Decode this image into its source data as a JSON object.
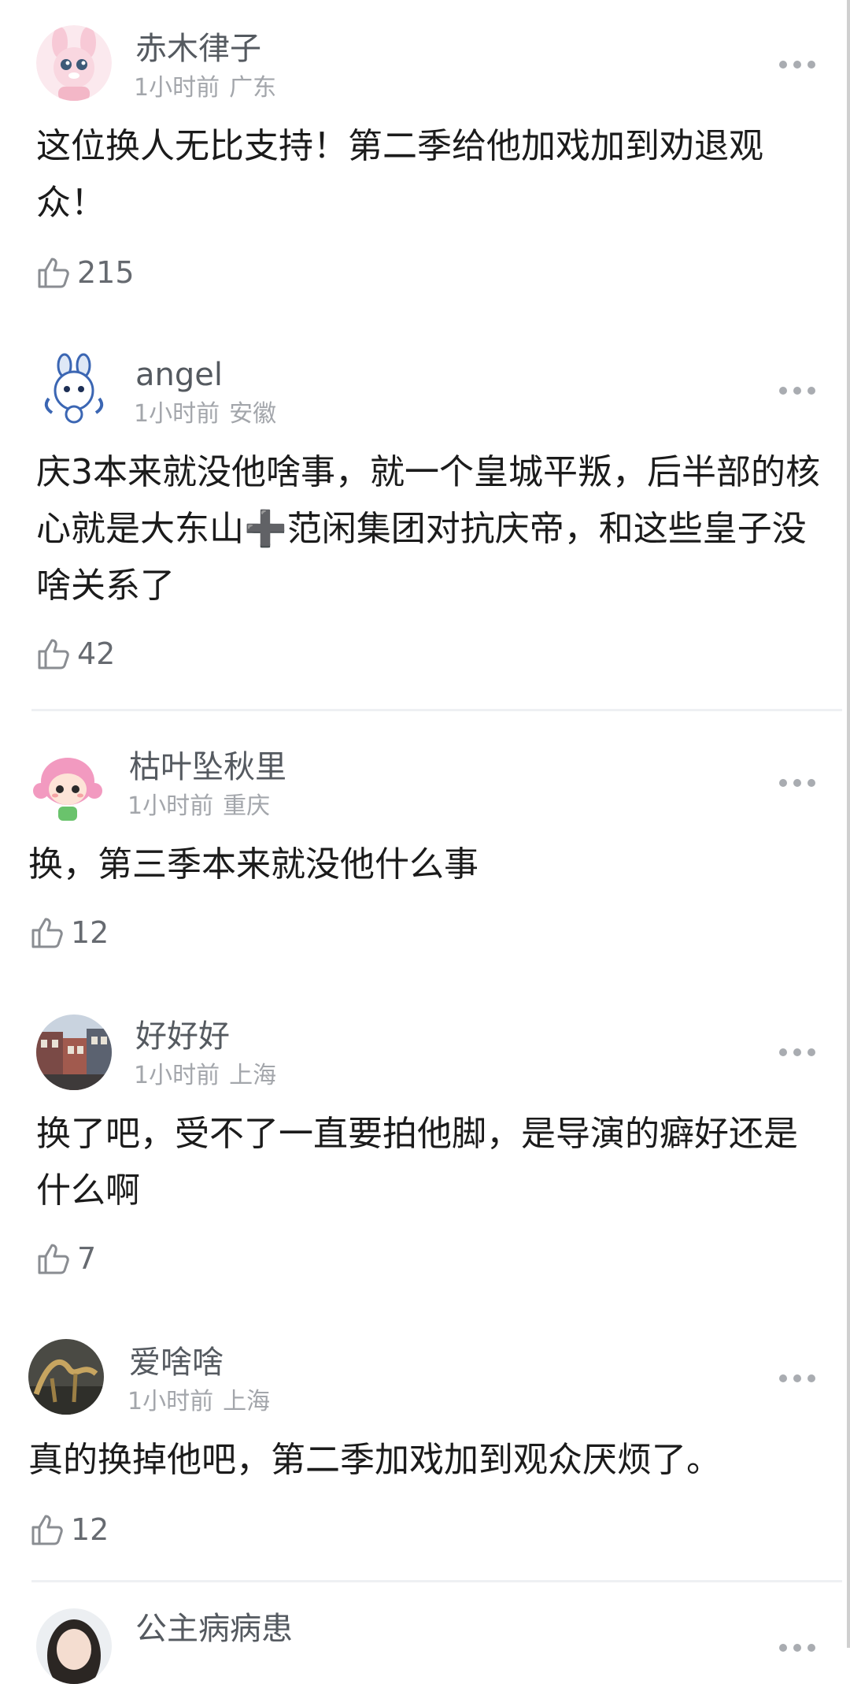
{
  "comments": [
    {
      "username": "赤木律子",
      "time": "1小时前",
      "location": "广东",
      "text": "这位换人无比支持！第二季给他加戏加到劝退观众！",
      "likes": "215",
      "avatar_icon": "pink-bunny-avatar-icon"
    },
    {
      "username": "angel",
      "time": "1小时前",
      "location": "安徽",
      "text": "庆3本来就没他啥事，就一个皇城平叛，后半部的核心就是大东山➕范闲集团对抗庆帝，和这些皇子没啥关系了",
      "likes": "42",
      "avatar_icon": "porcelain-rabbit-avatar-icon"
    },
    {
      "username": "枯叶坠秋里",
      "time": "1小时前",
      "location": "重庆",
      "text": "换，第三季本来就没他什么事",
      "likes": "12",
      "avatar_icon": "cartoon-girl-avatar-icon"
    },
    {
      "username": "好好好",
      "time": "1小时前",
      "location": "上海",
      "text": "换了吧，受不了一直要拍他脚，是导演的癖好还是什么啊",
      "likes": "7",
      "avatar_icon": "street-buildings-avatar-icon"
    },
    {
      "username": "爱啥啥",
      "time": "1小时前",
      "location": "上海",
      "text": "真的换掉他吧，第二季加戏加到观众厌烦了。",
      "likes": "12",
      "avatar_icon": "dark-sculpture-avatar-icon"
    },
    {
      "username": "公主病病患",
      "avatar_icon": "girl-photo-avatar-icon"
    }
  ],
  "colors": {
    "username": "#555a60",
    "meta": "#a3a6ab",
    "body_text": "#1b1b1b",
    "divider": "#eef0f3"
  }
}
